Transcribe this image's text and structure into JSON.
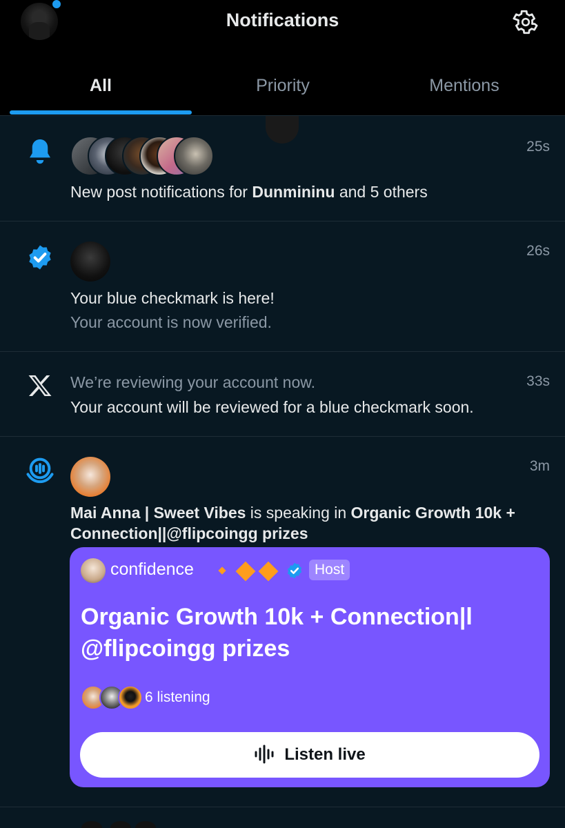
{
  "header": {
    "title": "Notifications",
    "tabs": [
      {
        "label": "All",
        "active": true
      },
      {
        "label": "Priority",
        "active": false
      },
      {
        "label": "Mentions",
        "active": false
      }
    ],
    "accent_color": "#1d9bf0"
  },
  "notifications": [
    {
      "type": "new-post",
      "icon": "bell-icon",
      "time": "25s",
      "text_pre": "New post notifications for ",
      "text_bold": "Dunmininu",
      "text_post": " and 5 others"
    },
    {
      "type": "verified",
      "icon": "verified-badge-icon",
      "time": "26s",
      "line1": "Your blue checkmark is here!",
      "line2": "Your account is now verified."
    },
    {
      "type": "review",
      "icon": "x-logo-icon",
      "time": "33s",
      "line1": "We’re reviewing your account now.",
      "line2": "Your account will be reviewed for a blue checkmark soon."
    },
    {
      "type": "space",
      "icon": "spaces-icon",
      "time": "3m",
      "speaker": "Mai Anna | Sweet Vibes",
      "middle": " is speaking in ",
      "space_name": "Organic Growth 10k + Connection||@flipcoingg prizes",
      "card": {
        "host_name": "confidence",
        "host_badge": "Host",
        "title": "Organic Growth 10k + Connection|l @flipcoingg prizes",
        "listening": "6 listening",
        "button_label": "Listen live",
        "card_color": "#7856ff"
      }
    }
  ]
}
